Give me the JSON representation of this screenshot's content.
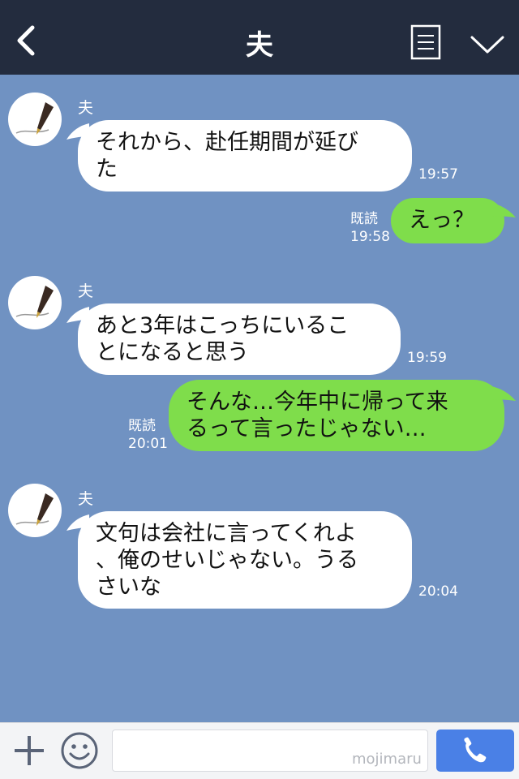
{
  "header": {
    "title": "夫",
    "icons": [
      "back-chevron-icon",
      "note-icon",
      "chevron-down-icon"
    ]
  },
  "messages": [
    {
      "side": "in",
      "sender": "夫",
      "lines": [
        "それから、赴任期間が延び",
        "た"
      ],
      "time": "19:57"
    },
    {
      "side": "out",
      "read": "既読",
      "lines": [
        "えっ？"
      ],
      "time": "19:58"
    },
    {
      "side": "in",
      "sender": "夫",
      "lines": [
        "あと3年はこっちにいるこ",
        "とになると思う"
      ],
      "time": "19:59"
    },
    {
      "side": "out",
      "read": "既読",
      "lines": [
        "そんな…今年中に帰って来",
        "るって言ったじゃない…"
      ],
      "time": "20:01"
    },
    {
      "side": "in",
      "sender": "夫",
      "lines": [
        "文句は会社に言ってくれよ",
        "、俺のせいじゃない。うる",
        "さいな"
      ],
      "time": "20:04"
    }
  ],
  "footer": {
    "input_value": "",
    "watermark": "mojimaru",
    "icons": [
      "plus-icon",
      "emoji-icon",
      "phone-icon"
    ]
  },
  "colors": {
    "header_bg": "#232c3e",
    "chat_bg": "#7092c2",
    "incoming_bubble": "#ffffff",
    "outgoing_bubble": "#7fdd4b",
    "call_button": "#4a80e6"
  }
}
